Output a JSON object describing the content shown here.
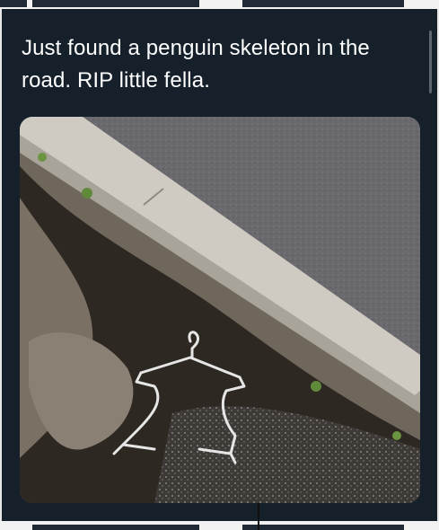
{
  "tweet": {
    "text_line1": "Just found a penguin skeleton in the",
    "text_line2": "road. RIP little fella."
  },
  "media": {
    "description_icon": "photo-hanger-on-road"
  },
  "colors": {
    "background": "#15202b",
    "text": "#ffffff",
    "asphalt": "#5d5d61",
    "curb": "#cfcbc2",
    "dirt": "#2f2924"
  }
}
